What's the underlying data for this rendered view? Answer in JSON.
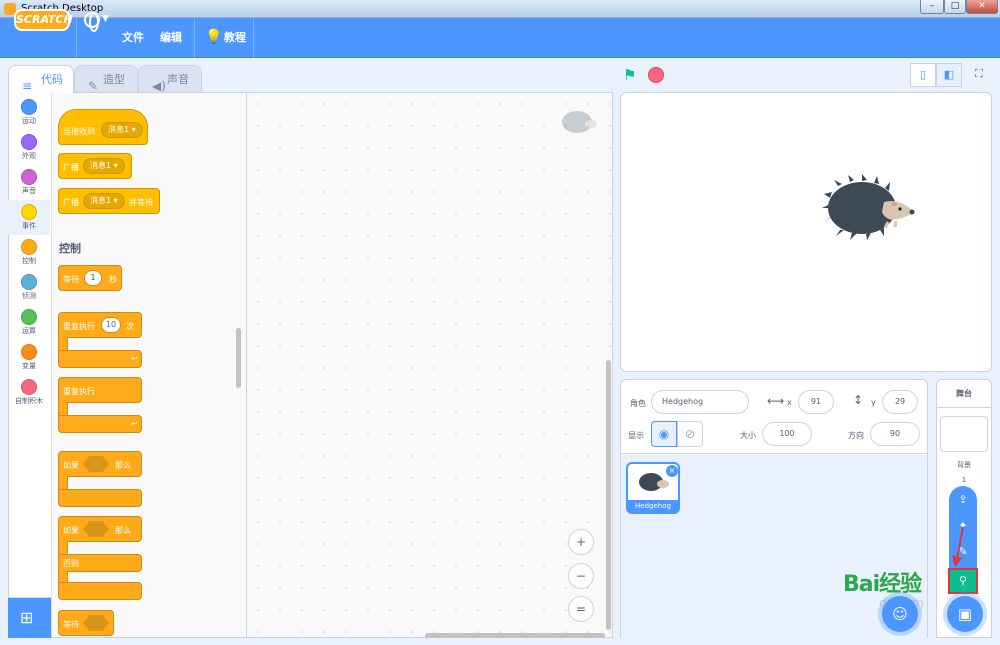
{
  "window": {
    "title": "Scratch Desktop",
    "controls": [
      "–",
      "□",
      "✕"
    ]
  },
  "menubar": {
    "logo": "SCRATCH",
    "file": "文件",
    "edit": "编辑",
    "tutorials": "教程"
  },
  "tabs": [
    {
      "label": "代码",
      "active": true
    },
    {
      "label": "造型",
      "active": false
    },
    {
      "label": "声音",
      "active": false
    }
  ],
  "categories": [
    {
      "label": "运动",
      "color": "#4c97ff"
    },
    {
      "label": "外观",
      "color": "#9966ff"
    },
    {
      "label": "声音",
      "color": "#cf63cf"
    },
    {
      "label": "事件",
      "color": "#ffd500"
    },
    {
      "label": "控制",
      "color": "#ffab19"
    },
    {
      "label": "侦测",
      "color": "#5cb1d6"
    },
    {
      "label": "运算",
      "color": "#59c059"
    },
    {
      "label": "变量",
      "color": "#ff8c1a"
    },
    {
      "label": "自制积木",
      "color": "#ff6680"
    }
  ],
  "palette": {
    "event_blocks": [
      {
        "text": "当接收到",
        "dropdown": "消息1"
      },
      {
        "text": "广播",
        "dropdown": "消息1"
      },
      {
        "text": "广播",
        "dropdown": "消息1",
        "suffix": "并等待"
      }
    ],
    "section_control": "控制",
    "wait": {
      "text": "等待",
      "value": "1",
      "suffix": "秒"
    },
    "repeat": {
      "text": "重复执行",
      "value": "10",
      "suffix": "次"
    },
    "forever": {
      "text": "重复执行"
    },
    "if_then": {
      "text": "如果",
      "suffix": "那么"
    },
    "if_else": {
      "text": "如果",
      "suffix": "那么",
      "else": "否则"
    },
    "wait_until": {
      "text": "等待"
    }
  },
  "workspace": {
    "zoom_in": "+",
    "zoom_out": "−",
    "zoom_reset": "="
  },
  "sprite_info": {
    "sprite_label": "角色",
    "sprite_name": "Hedgehog",
    "x_label": "x",
    "x_value": "91",
    "y_label": "y",
    "y_value": "29",
    "show_label": "显示",
    "size_label": "大小",
    "size_value": "100",
    "direction_label": "方向",
    "direction_value": "90"
  },
  "sprites": [
    {
      "name": "Hedgehog",
      "selected": true
    }
  ],
  "stage_pane": {
    "title": "舞台",
    "backdrop_label": "背景",
    "backdrop_count": "1"
  },
  "watermark": {
    "text1": "Bai经验",
    "text2": "du.com"
  },
  "colors": {
    "accent": "#4c97ff",
    "events": "#ffbf00",
    "control": "#ffab19",
    "green_flag": "#0fbd8c",
    "stop": "#ff6680"
  }
}
